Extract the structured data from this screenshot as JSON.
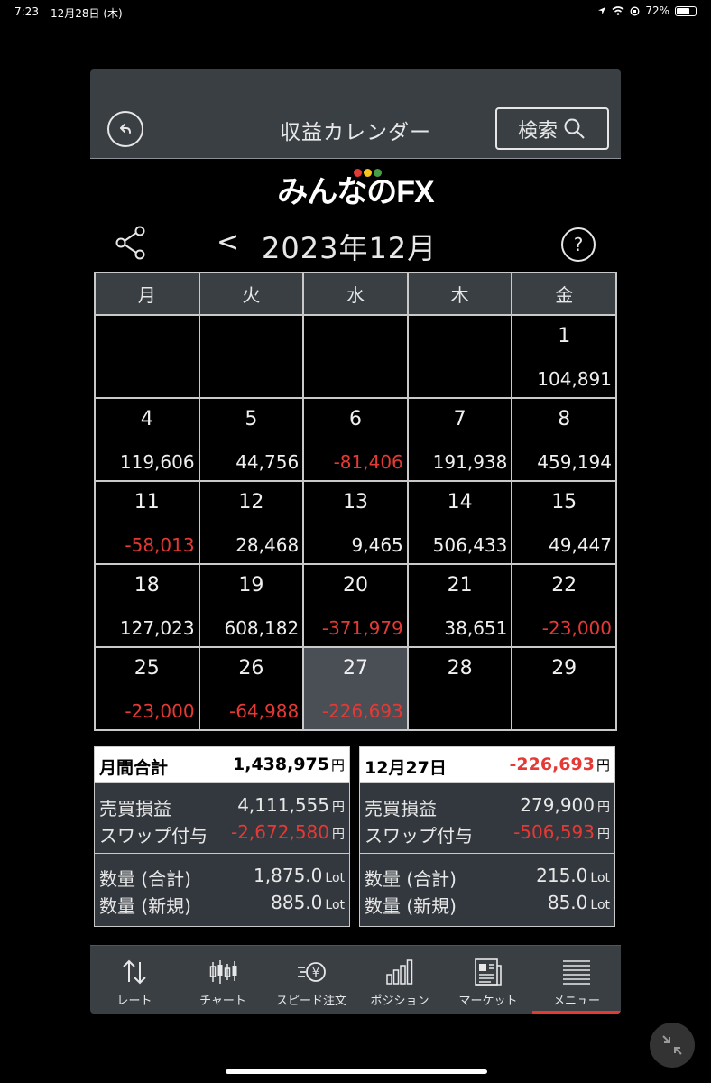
{
  "status_bar": {
    "time": "7:23",
    "date": "12月28日 (木)",
    "battery": "72%",
    "battery_level": 0.72
  },
  "header": {
    "title": "収益カレンダー",
    "search_label": "検索"
  },
  "logo": {
    "text": "みんなのFX",
    "dot_colors": [
      "#e53935",
      "#f9c516",
      "#43a047"
    ]
  },
  "calendar": {
    "month_label": "2023年12月",
    "prev_label": "<",
    "help_label": "?",
    "weekdays": [
      "月",
      "火",
      "水",
      "木",
      "金"
    ],
    "weeks": [
      [
        {
          "day": "",
          "value": ""
        },
        {
          "day": "",
          "value": ""
        },
        {
          "day": "",
          "value": ""
        },
        {
          "day": "",
          "value": ""
        },
        {
          "day": "1",
          "value": "104,891"
        }
      ],
      [
        {
          "day": "4",
          "value": "119,606"
        },
        {
          "day": "5",
          "value": "44,756"
        },
        {
          "day": "6",
          "value": "-81,406"
        },
        {
          "day": "7",
          "value": "191,938"
        },
        {
          "day": "8",
          "value": "459,194"
        }
      ],
      [
        {
          "day": "11",
          "value": "-58,013"
        },
        {
          "day": "12",
          "value": "28,468"
        },
        {
          "day": "13",
          "value": "9,465"
        },
        {
          "day": "14",
          "value": "506,433"
        },
        {
          "day": "15",
          "value": "49,447"
        }
      ],
      [
        {
          "day": "18",
          "value": "127,023"
        },
        {
          "day": "19",
          "value": "608,182"
        },
        {
          "day": "20",
          "value": "-371,979"
        },
        {
          "day": "21",
          "value": "38,651"
        },
        {
          "day": "22",
          "value": "-23,000"
        }
      ],
      [
        {
          "day": "25",
          "value": "-23,000"
        },
        {
          "day": "26",
          "value": "-64,988"
        },
        {
          "day": "27",
          "value": "-226,693",
          "selected": true
        },
        {
          "day": "28",
          "value": ""
        },
        {
          "day": "29",
          "value": ""
        }
      ]
    ]
  },
  "monthly_summary": {
    "label": "月間合計",
    "total": "1,438,975",
    "yen": "円",
    "trade_pl_label": "売買損益",
    "trade_pl": "4,111,555",
    "swap_label": "スワップ付与",
    "swap": "-2,672,580",
    "qty_total_label": "数量 (合計)",
    "qty_total": "1,875.0",
    "qty_new_label": "数量 (新規)",
    "qty_new": "885.0",
    "lot": "Lot"
  },
  "daily_summary": {
    "label": "12月27日",
    "total": "-226,693",
    "yen": "円",
    "trade_pl_label": "売買損益",
    "trade_pl": "279,900",
    "swap_label": "スワップ付与",
    "swap": "-506,593",
    "qty_total_label": "数量 (合計)",
    "qty_total": "215.0",
    "qty_new_label": "数量 (新規)",
    "qty_new": "85.0",
    "lot": "Lot"
  },
  "tabs": [
    {
      "label": "レート",
      "icon": "rate-arrows-icon"
    },
    {
      "label": "チャート",
      "icon": "candlestick-chart-icon"
    },
    {
      "label": "スピード注文",
      "icon": "speed-order-icon"
    },
    {
      "label": "ポジション",
      "icon": "position-bars-icon"
    },
    {
      "label": "マーケット",
      "icon": "newspaper-icon"
    },
    {
      "label": "メニュー",
      "icon": "menu-list-icon",
      "active": true
    }
  ],
  "colors": {
    "negative": "#e53935",
    "header_bg": "#3a3f44",
    "active_tab": "#e53935"
  }
}
